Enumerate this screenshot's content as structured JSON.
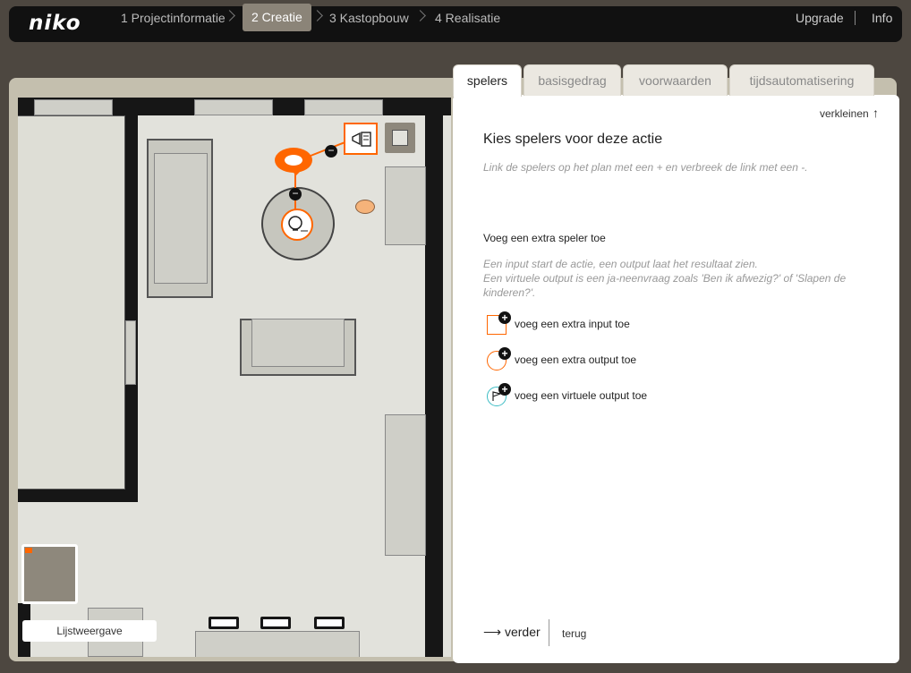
{
  "topbar": {
    "logo": "niko",
    "steps": [
      "1 Projectinformatie",
      "2 Creatie",
      "3 Kastopbouw",
      "4 Realisatie"
    ],
    "upgrade": "Upgrade",
    "info": "Info"
  },
  "panel": {
    "tabs": [
      "spelers",
      "basisgedrag",
      "voorwaarden",
      "tijdsautomatisering"
    ],
    "collapse": "verkleinen",
    "title": "Kies spelers voor deze actie",
    "intro": "Link de spelers op het plan met een + en verbreek de link met een -.",
    "add_heading": "Voeg een extra speler toe",
    "add_help_1": "Een input start de actie, een output laat het resultaat zien.",
    "add_help_2": "Een virtuele output is een ja-neenvraag zoals 'Ben ik afwezig?' of 'Slapen de",
    "add_help_3": "kinderen?'.",
    "add_input": "voeg een extra input toe",
    "add_output": "voeg een extra output toe",
    "add_virtual": "voeg een virtuele output toe",
    "next": "verder",
    "back": "terug"
  },
  "plan": {
    "list_view": "Lijstweergave"
  },
  "icons": {
    "collapse": "arrow-up-icon",
    "next": "arrow-right-icon",
    "input": "input-square-icon",
    "output": "output-circle-icon",
    "virtual": "virtual-output-icon"
  },
  "colors": {
    "accent": "#ff6600",
    "active_step": "#8b8478",
    "background": "#4d4740"
  }
}
